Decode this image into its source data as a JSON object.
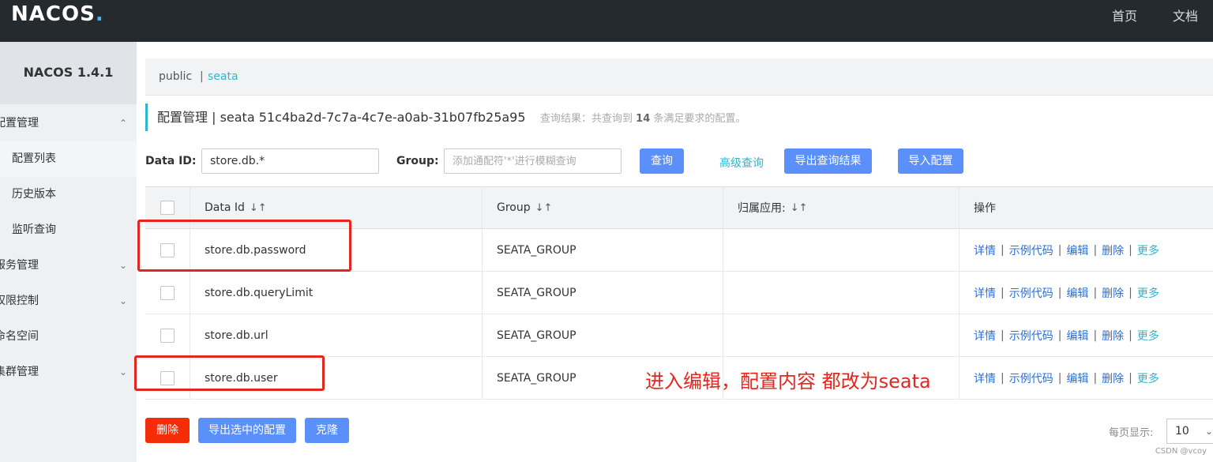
{
  "header": {
    "logo_a": "NAC",
    "logo_o": "O",
    "logo_b": "S",
    "logo_dot": ".",
    "nav_home": "首页",
    "nav_docs": "文档"
  },
  "sidebar": {
    "title": "NACOS 1.4.1",
    "items": [
      {
        "label": "配置管理"
      },
      {
        "label": "配置列表"
      },
      {
        "label": "历史版本"
      },
      {
        "label": "监听查询"
      },
      {
        "label": "服务管理"
      },
      {
        "label": "权限控制"
      },
      {
        "label": "命名空间"
      },
      {
        "label": "集群管理"
      }
    ]
  },
  "namespace": {
    "public": "public",
    "separator": "|",
    "seata": "seata"
  },
  "title": {
    "main": "配置管理 | seata 51c4ba2d-7c7a-4c7e-a0ab-31b07fb25a95",
    "result_prefix": "查询结果：共查询到",
    "result_count": "14",
    "result_suffix": "条满足要求的配置。"
  },
  "search": {
    "dataid_label": "Data ID:",
    "dataid_value": "store.db.*",
    "group_label": "Group:",
    "group_placeholder": "添加通配符'*'进行模糊查询",
    "query_btn": "查询",
    "advanced": "高级查询",
    "export_btn": "导出查询结果",
    "import_btn": "导入配置"
  },
  "table": {
    "headers": {
      "dataid": "Data Id",
      "group": "Group",
      "app": "归属应用:",
      "ops": "操作",
      "sort_icon": "↓↑"
    },
    "rows": [
      {
        "dataid": "store.db.password",
        "group": "SEATA_GROUP",
        "app": ""
      },
      {
        "dataid": "store.db.queryLimit",
        "group": "SEATA_GROUP",
        "app": ""
      },
      {
        "dataid": "store.db.url",
        "group": "SEATA_GROUP",
        "app": ""
      },
      {
        "dataid": "store.db.user",
        "group": "SEATA_GROUP",
        "app": ""
      }
    ],
    "ops": {
      "detail": "详情",
      "sample": "示例代码",
      "edit": "编辑",
      "delete": "删除",
      "more": "更多",
      "sep": "|"
    }
  },
  "annotation": "进入编辑，配置内容 都改为seata",
  "footer": {
    "delete_btn": "删除",
    "export_selected_btn": "导出选中的配置",
    "clone_btn": "克隆",
    "page_size_label": "每页显示:",
    "page_size_value": "10"
  },
  "watermark": "CSDN @vcoy",
  "colors": {
    "topbar": "#252a2f",
    "primary": "#5b8ff9",
    "danger": "#f52c08",
    "accent": "#2eb5cf",
    "annotation": "#e5261e"
  }
}
